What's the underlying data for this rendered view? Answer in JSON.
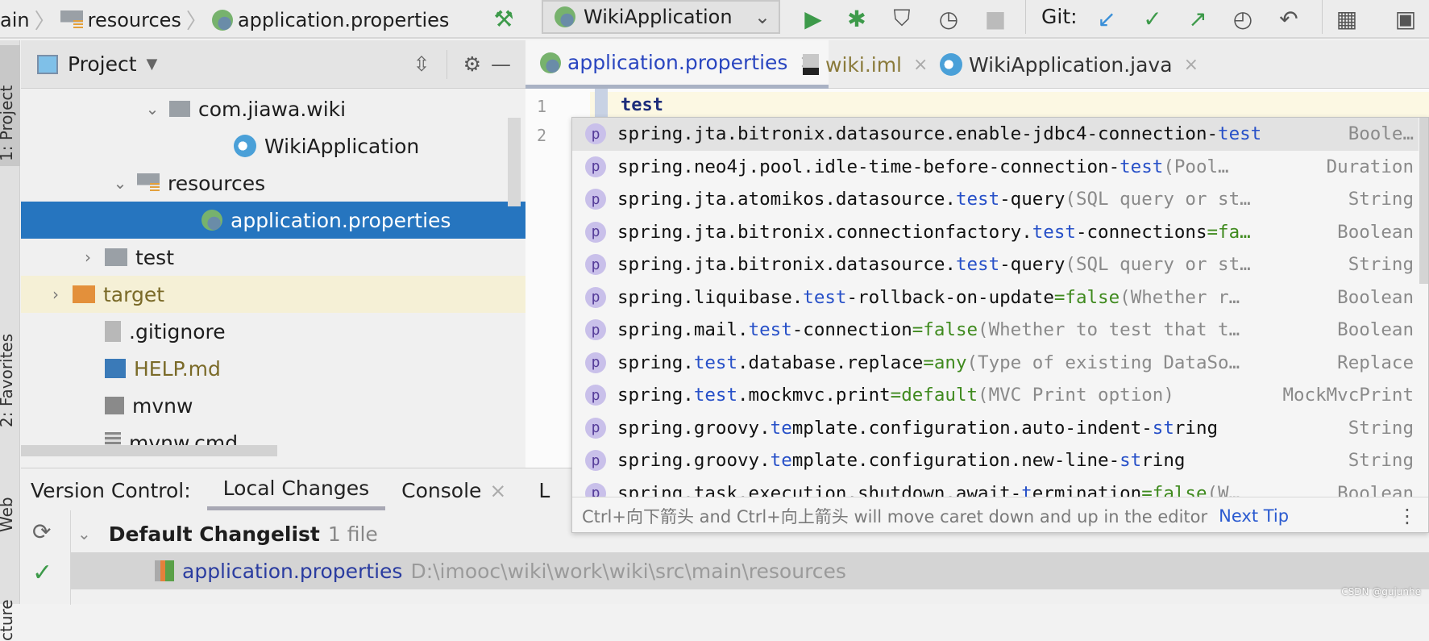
{
  "breadcrumb": [
    "ain",
    "resources",
    "application.properties"
  ],
  "run_config": "WikiApplication",
  "git_label": "Git:",
  "left_stripe": {
    "project": "1: Project",
    "favorites": "2: Favorites",
    "web": "Web",
    "structure": "cture"
  },
  "project": {
    "title": "Project",
    "tree": [
      {
        "label": "com.jiawa.wiki",
        "indent": 4,
        "chev": "⌄",
        "icon": "package"
      },
      {
        "label": "WikiApplication",
        "indent": 6,
        "chev": "",
        "icon": "spring-class"
      },
      {
        "label": "resources",
        "indent": 3,
        "chev": "⌄",
        "icon": "resources-folder"
      },
      {
        "label": "application.properties",
        "indent": 5,
        "chev": "",
        "icon": "spring-properties",
        "selected": true
      },
      {
        "label": "test",
        "indent": 2,
        "chev": "›",
        "icon": "folder"
      },
      {
        "label": "target",
        "indent": 1,
        "chev": "›",
        "icon": "excluded-folder",
        "excluded": true
      },
      {
        "label": ".gitignore",
        "indent": 2,
        "chev": "",
        "icon": "file"
      },
      {
        "label": "HELP.md",
        "indent": 2,
        "chev": "",
        "icon": "markdown",
        "color": "#7a6a28"
      },
      {
        "label": "mvnw",
        "indent": 2,
        "chev": "",
        "icon": "shell"
      },
      {
        "label": "mvnw.cmd",
        "indent": 2,
        "chev": "",
        "icon": "text-file"
      }
    ]
  },
  "editor_tabs": [
    {
      "label": "application.properties",
      "active": true
    },
    {
      "label": "wiki.iml",
      "color": "#8a7a3a"
    },
    {
      "label": "WikiApplication.java"
    }
  ],
  "editor": {
    "lines": [
      "1",
      "2"
    ],
    "code": "test"
  },
  "completion": {
    "items": [
      {
        "segs": [
          [
            "n",
            "spring.jta.bitronix.datasource.enable-jdbc4-connection-"
          ],
          [
            "m",
            "test"
          ]
        ],
        "type": "Boole…"
      },
      {
        "segs": [
          [
            "n",
            "spring.neo4j.pool.idle-time-before-connection-"
          ],
          [
            "m",
            "test"
          ],
          [
            "d",
            " (Pool…"
          ]
        ],
        "type": "Duration"
      },
      {
        "segs": [
          [
            "n",
            "spring.jta.atomikos.datasource."
          ],
          [
            "m",
            "test"
          ],
          [
            "n",
            "-query"
          ],
          [
            "d",
            " (SQL query or st…"
          ]
        ],
        "type": "String"
      },
      {
        "segs": [
          [
            "n",
            "spring.jta.bitronix.connectionfactory."
          ],
          [
            "m",
            "test"
          ],
          [
            "n",
            "-connections"
          ],
          [
            "v",
            "=fa…"
          ]
        ],
        "type": "Boolean"
      },
      {
        "segs": [
          [
            "n",
            "spring.jta.bitronix.datasource."
          ],
          [
            "m",
            "test"
          ],
          [
            "n",
            "-query"
          ],
          [
            "d",
            " (SQL query or st…"
          ]
        ],
        "type": "String"
      },
      {
        "segs": [
          [
            "n",
            "spring.liquibase."
          ],
          [
            "m",
            "test"
          ],
          [
            "n",
            "-rollback-on-update"
          ],
          [
            "v",
            "=false"
          ],
          [
            "d",
            " (Whether r…"
          ]
        ],
        "type": "Boolean"
      },
      {
        "segs": [
          [
            "n",
            "spring.mail."
          ],
          [
            "m",
            "test"
          ],
          [
            "n",
            "-connection"
          ],
          [
            "v",
            "=false"
          ],
          [
            "d",
            " (Whether to test that t…"
          ]
        ],
        "type": "Boolean"
      },
      {
        "segs": [
          [
            "n",
            "spring."
          ],
          [
            "m",
            "test"
          ],
          [
            "n",
            ".database.replace"
          ],
          [
            "v",
            "=any"
          ],
          [
            "d",
            " (Type of existing DataSo…"
          ]
        ],
        "type": "Replace"
      },
      {
        "segs": [
          [
            "n",
            "spring."
          ],
          [
            "m",
            "test"
          ],
          [
            "n",
            ".mockmvc.print"
          ],
          [
            "v",
            "=default"
          ],
          [
            "d",
            " (MVC Print option)"
          ]
        ],
        "type": "MockMvcPrint"
      },
      {
        "segs": [
          [
            "n",
            "spring.groovy."
          ],
          [
            "m",
            "te"
          ],
          [
            "n",
            "mplate.configuration.auto-indent-"
          ],
          [
            "m",
            "st"
          ],
          [
            "n",
            "ring"
          ]
        ],
        "type": "String"
      },
      {
        "segs": [
          [
            "n",
            "spring.groovy."
          ],
          [
            "m",
            "te"
          ],
          [
            "n",
            "mplate.configuration.new-line-"
          ],
          [
            "m",
            "st"
          ],
          [
            "n",
            "ring"
          ]
        ],
        "type": "String"
      },
      {
        "segs": [
          [
            "n",
            "spring.task.execution.shutdown.await-"
          ],
          [
            "m",
            "t"
          ],
          [
            "n",
            "ermination"
          ],
          [
            "v",
            "=false"
          ],
          [
            "d",
            " (W…"
          ]
        ],
        "type": "Boolean"
      }
    ],
    "tip": "Ctrl+向下箭头 and Ctrl+向上箭头 will move caret down and up in the editor",
    "next_tip": "Next Tip"
  },
  "bottom": {
    "label": "Version Control:",
    "tabs": [
      "Local Changes",
      "Console",
      "L"
    ],
    "changelist": "Default Changelist",
    "count": "1 file",
    "file": "application.properties",
    "path": "D:\\imooc\\wiki\\work\\wiki\\src\\main\\resources"
  },
  "watermark": "CSDN @gujunhe",
  "colors": {
    "selection": "#2675bf",
    "match": "#2750c8",
    "value": "#3f8a1e",
    "run": "#3d9a4a"
  }
}
